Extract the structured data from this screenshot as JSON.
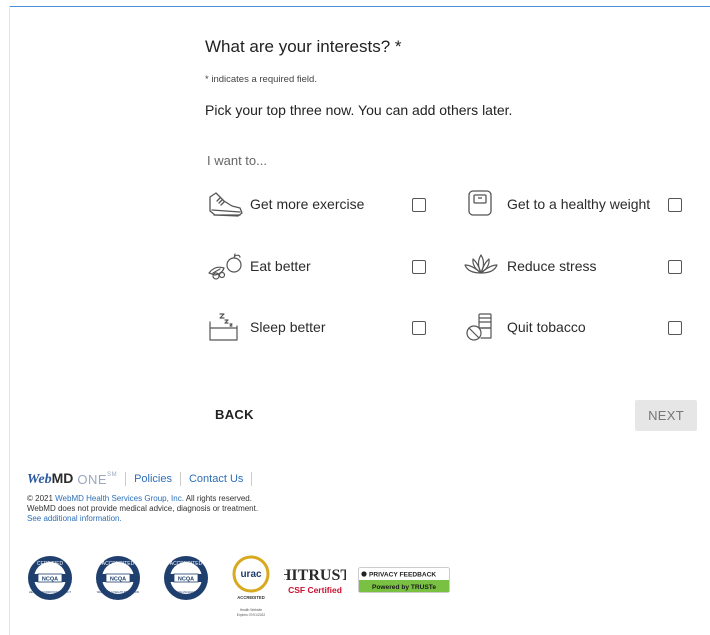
{
  "form": {
    "title": "What are your interests? *",
    "required_note": "* indicates a required field.",
    "intro": "Pick your top three now. You can add others later.",
    "prompt": "I want to..."
  },
  "options": [
    {
      "label": "Get more exercise",
      "icon": "sneaker-icon",
      "checked": false
    },
    {
      "label": "Get to a healthy weight",
      "icon": "scale-icon",
      "checked": false
    },
    {
      "label": "Eat better",
      "icon": "produce-icon",
      "checked": false
    },
    {
      "label": "Reduce stress",
      "icon": "lotus-icon",
      "checked": false
    },
    {
      "label": "Sleep better",
      "icon": "bed-icon",
      "checked": false
    },
    {
      "label": "Quit tobacco",
      "icon": "no-smoking-icon",
      "checked": false
    }
  ],
  "nav": {
    "back_label": "BACK",
    "next_label": "NEXT"
  },
  "footer": {
    "brand_web": "Web",
    "brand_md": "MD",
    "brand_one": "ONE",
    "brand_sm": "SM",
    "policies_label": "Policies",
    "contact_label": "Contact Us",
    "copyright_prefix": "© 2021 ",
    "company_link": "WebMD Health Services Group, Inc.",
    "copyright_suffix": " All rights reserved.",
    "disclaimer": "WebMD does not provide medical advice, diagnosis or treatment.",
    "additional_info": "See additional information."
  },
  "badges": {
    "ncqa1_top": "CERTIFIED",
    "ncqa1_mid": "NCQA",
    "ncqa1_bottom": "HEALTH INFORMATION PRODUCT",
    "ncqa2_top": "ACCREDITED",
    "ncqa2_mid": "NCQA",
    "ncqa2_bottom": "WELLNESS & HEALTH PROMOTION",
    "ncqa3_top": "ACCREDITED",
    "ncqa3_mid": "NCQA",
    "ncqa3_bottom": "DISEASE MANAGEMENT",
    "urac_name": "urac",
    "urac_accredited": "ACCREDITED",
    "urac_line1": "Health Website",
    "urac_line2": "Expires 07/01/2022",
    "hitrust_name": "HITRUST",
    "hitrust_sub": "CSF Certified",
    "truste_top": "PRIVACY FEEDBACK",
    "truste_bottom": "Powered by TRUSTe"
  },
  "colors": {
    "link": "#2c6fb8",
    "ncqa_navy": "#1f3f6e",
    "urac_gold": "#d8a91e",
    "hitrust_red": "#c8102e",
    "truste_green": "#7ac143",
    "next_disabled_bg": "#e6e6e6"
  }
}
